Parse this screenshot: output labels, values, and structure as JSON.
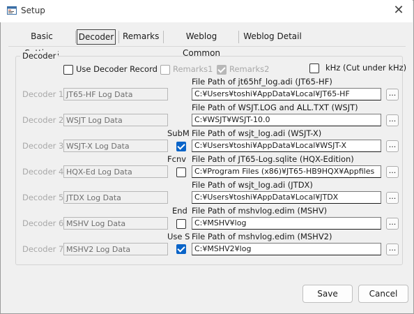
{
  "window": {
    "title": "Setup",
    "close_glyph": "✕"
  },
  "tabs": [
    {
      "label": "Basic Settings"
    },
    {
      "label": "Decoder",
      "selected": true
    },
    {
      "label": "Remarks"
    },
    {
      "label": "Weblog Common"
    },
    {
      "label": "Weblog Detail"
    }
  ],
  "group": {
    "label": "Decoder"
  },
  "options": {
    "use_decoder_record": {
      "label": "Use Decoder Record",
      "checked": false
    },
    "remarks1": {
      "label": "Remarks1",
      "checked": false,
      "enabled": false
    },
    "remarks2": {
      "label": "Remarks2",
      "checked": true,
      "enabled": false
    },
    "khz": {
      "label": "kHz (Cut under kHz)",
      "checked": false
    }
  },
  "decoders": [
    {
      "label": "Decoder 1",
      "log": "JT65-HF Log Data",
      "extra_label": "",
      "has_checkbox": false,
      "checked": false,
      "path_label": "File Path of jt65hf_log.adi (JT65-HF)",
      "path": "C:¥Users¥toshi¥AppData¥Local¥JT65-HF"
    },
    {
      "label": "Decoder 2",
      "log": "WSJT Log Data",
      "extra_label": "",
      "has_checkbox": false,
      "checked": false,
      "path_label": "File Path of WSJT.LOG and ALL.TXT (WSJT)",
      "path": "C:¥WSJT¥WSJT-10.0"
    },
    {
      "label": "Decoder 3",
      "log": "WSJT-X Log Data",
      "extra_label": "SubM",
      "has_checkbox": true,
      "checked": true,
      "path_label": "File Path of wsjt_log.adi (WSJT-X)",
      "path": "C:¥Users¥toshi¥AppData¥Local¥WSJT-X"
    },
    {
      "label": "Decoder 4",
      "log": "HQX-Ed Log Data",
      "extra_label": "Fcnv",
      "has_checkbox": true,
      "checked": false,
      "path_label": "File Path of JT65-Log.sqlite (HQX-Edition)",
      "path": "C:¥Program Files (x86)¥JT65-HB9HQX¥Appfiles"
    },
    {
      "label": "Decoder 5",
      "log": "JTDX Log Data",
      "extra_label": "",
      "has_checkbox": false,
      "checked": false,
      "path_label": "File Path of wsjt_log.adi (JTDX)",
      "path": "C:¥Users¥toshi¥AppData¥Local¥JTDX"
    },
    {
      "label": "Decoder 6",
      "log": "MSHV Log Data",
      "extra_label": "End",
      "has_checkbox": true,
      "checked": false,
      "path_label": "File Path of mshvlog.edim (MSHV)",
      "path": "C:¥MSHV¥log"
    },
    {
      "label": "Decoder 7",
      "log": "MSHV2 Log Data",
      "extra_label": "Use S",
      "has_checkbox": true,
      "checked": true,
      "path_label": "File Path of mshvlog.edim (MSHV2)",
      "path": "C:¥MSHV2¥log"
    }
  ],
  "browse_label": "...",
  "buttons": {
    "save": "Save",
    "cancel": "Cancel"
  },
  "colors": {
    "accent": "#0a64c8",
    "disabled_text": "#a8a8a8"
  }
}
